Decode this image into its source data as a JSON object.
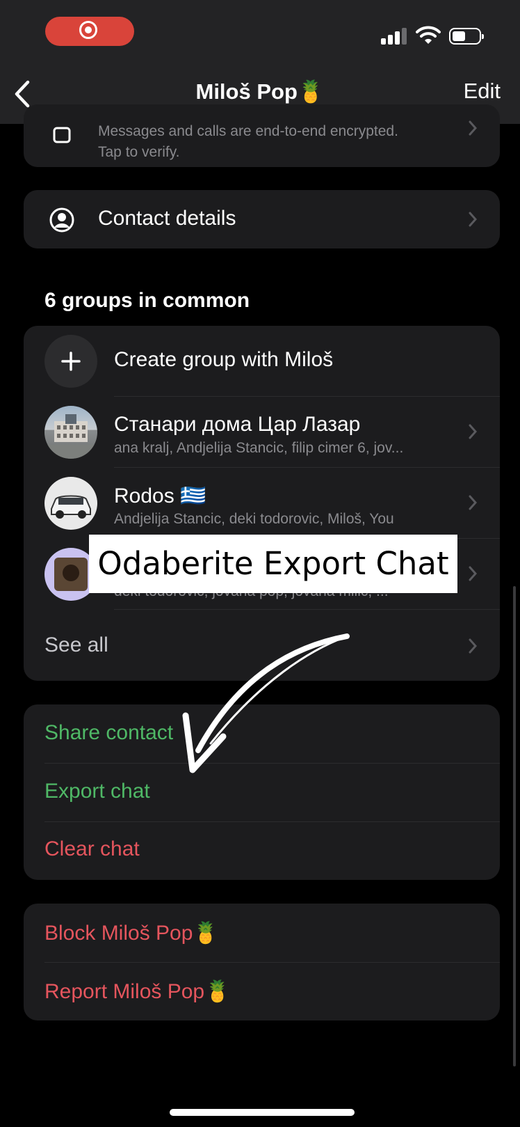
{
  "status_bar": {
    "recording_indicator": "record-icon",
    "signal_icon": "cellular-signal-icon",
    "wifi_icon": "wifi-icon",
    "battery_icon": "battery-icon"
  },
  "header": {
    "title": "Miloš Pop🍍",
    "edit_label": "Edit",
    "back_icon": "chevron-left-icon"
  },
  "encryption": {
    "line1": "Messages and calls are end-to-end encrypted.",
    "line2": "Tap to verify."
  },
  "contact_details": {
    "label": "Contact details"
  },
  "groups": {
    "heading": "6 groups in common",
    "create_label": "Create group with Miloš",
    "items": [
      {
        "name": "Станари дома Цар Лазар",
        "members": "ana kralj, Andjelija Stancic, filip cimer 6, jov..."
      },
      {
        "name": "Rodos 🇬🇷",
        "members": "Andjelija Stancic, deki todorovic, Miloš, You"
      },
      {
        "name": "",
        "members": "deki todorovic, jovana pop, jovana milic, ..."
      }
    ],
    "see_all": "See all"
  },
  "actions": {
    "share_contact": "Share contact",
    "export_chat": "Export chat",
    "clear_chat": "Clear chat"
  },
  "danger": {
    "block": "Block Miloš Pop🍍",
    "report": "Report Miloš Pop🍍"
  },
  "overlay": {
    "caption": "Odaberite Export Chat"
  },
  "colors": {
    "green": "#4fb866",
    "red": "#e5555d",
    "card": "#1c1c1e",
    "header": "#232325",
    "record": "#d9443a"
  }
}
